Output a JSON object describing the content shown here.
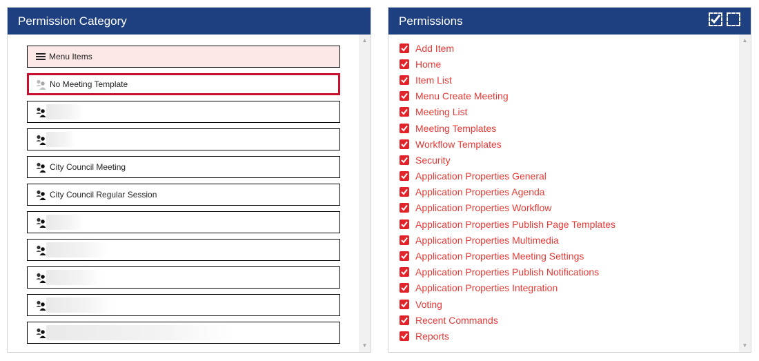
{
  "left_panel": {
    "title": "Permission Category",
    "items": [
      {
        "label": "Menu Items",
        "icon": "hamburger-menu-icon",
        "kind": "menu"
      },
      {
        "label": "No Meeting Template",
        "icon": "people-icon",
        "kind": "selected"
      },
      {
        "label": "",
        "icon": "people-icon",
        "kind": "redacted",
        "redacted": true
      },
      {
        "label": "",
        "icon": "people-icon",
        "kind": "redacted",
        "redacted": true
      },
      {
        "label": "City Council Meeting",
        "icon": "people-icon",
        "kind": "normal"
      },
      {
        "label": "City Council Regular Session",
        "icon": "people-icon",
        "kind": "normal"
      },
      {
        "label": "",
        "icon": "people-icon",
        "kind": "redacted",
        "redacted": true
      },
      {
        "label": "",
        "icon": "people-icon",
        "kind": "redacted",
        "redacted": true
      },
      {
        "label": "",
        "icon": "people-icon",
        "kind": "redacted",
        "redacted": true
      },
      {
        "label": "",
        "icon": "people-icon",
        "kind": "redacted",
        "redacted": true
      },
      {
        "label": "",
        "icon": "people-icon",
        "kind": "redacted",
        "redacted": true
      }
    ]
  },
  "right_panel": {
    "title": "Permissions",
    "header_icons": [
      "check-all-icon",
      "uncheck-all-icon"
    ],
    "items": [
      {
        "label": "Add Item",
        "checked": true
      },
      {
        "label": "Home",
        "checked": true
      },
      {
        "label": "Item List",
        "checked": true
      },
      {
        "label": "Menu Create Meeting",
        "checked": true
      },
      {
        "label": "Meeting List",
        "checked": true
      },
      {
        "label": "Meeting Templates",
        "checked": true
      },
      {
        "label": "Workflow Templates",
        "checked": true
      },
      {
        "label": "Security",
        "checked": true
      },
      {
        "label": "Application Properties General",
        "checked": true
      },
      {
        "label": "Application Properties Agenda",
        "checked": true
      },
      {
        "label": "Application Properties Workflow",
        "checked": true
      },
      {
        "label": "Application Properties Publish Page Templates",
        "checked": true
      },
      {
        "label": "Application Properties Multimedia",
        "checked": true
      },
      {
        "label": "Application Properties Meeting Settings",
        "checked": true
      },
      {
        "label": "Application Properties Publish Notifications",
        "checked": true
      },
      {
        "label": "Application Properties Integration",
        "checked": true
      },
      {
        "label": "Voting",
        "checked": true
      },
      {
        "label": "Recent Commands",
        "checked": true
      },
      {
        "label": "Reports",
        "checked": true
      }
    ]
  },
  "colors": {
    "header_bg": "#1f4080",
    "accent_red": "#e3232a",
    "selected_border": "#c8102e",
    "menu_item_bg": "#fde8e8"
  }
}
